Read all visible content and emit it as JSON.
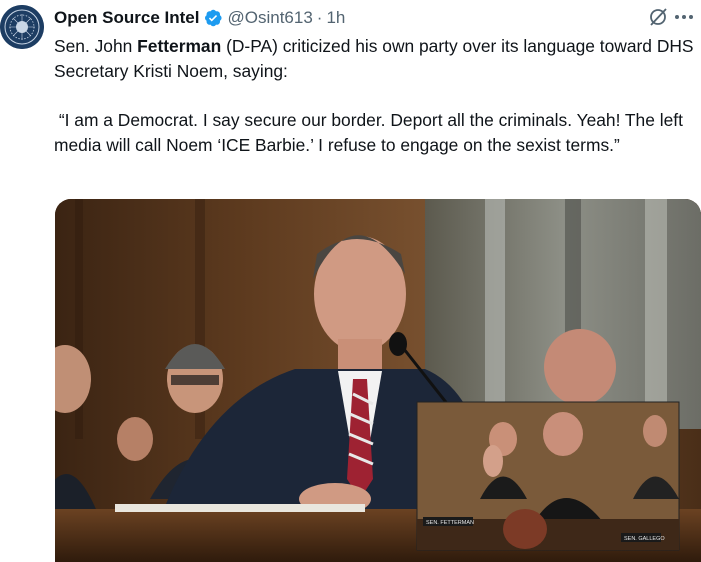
{
  "tweet": {
    "author_name": "Open Source Intel",
    "handle": "@Osint613",
    "separator": "·",
    "time": "1h",
    "text_part1": "Sen. John ",
    "text_bold": "Fetterman",
    "text_part2": " (D-PA) criticized his own party over its language toward DHS Secretary Kristi Noem, saying:",
    "quote": " “I am a Democrat. I say secure our border. Deport all the criminals. Yeah! The left media will call Noem ‘ICE Barbie.’ I refuse to engage on the sexist terms.”"
  },
  "media": {
    "nameplate_main": "SEN. FETTERMAN",
    "nameplate_side": "SEN. GALLEGO"
  },
  "icons": {
    "avatar": "seal-logo",
    "verified": "verified-badge-icon",
    "grok": "grok-icon",
    "more": "more-icon"
  },
  "colors": {
    "verified": "#1d9bf0",
    "secondary_text": "#536471",
    "primary_text": "#0f1419"
  }
}
